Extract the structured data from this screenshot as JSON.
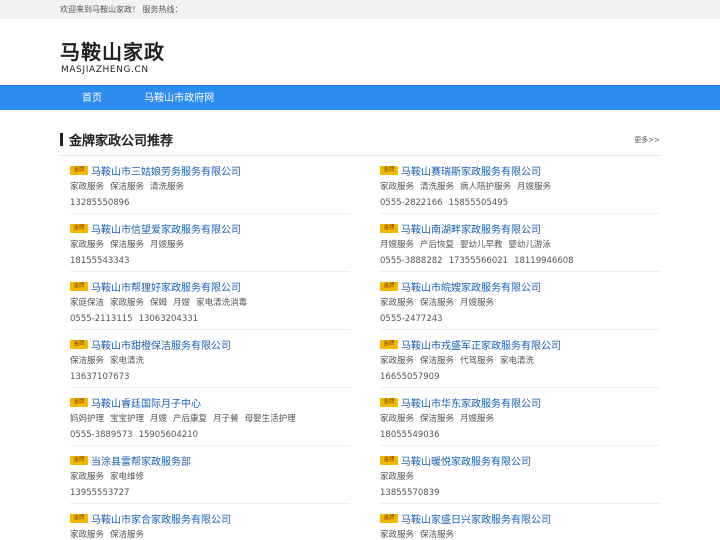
{
  "topbar": {
    "text": "欢迎来到马鞍山家政！  服务热线："
  },
  "logo": {
    "cn": "马鞍山家政",
    "en": "MASJIAZHENG.CN"
  },
  "nav": [
    {
      "label": "首页"
    },
    {
      "label": "马鞍山市政府网"
    }
  ],
  "section": {
    "title": "金牌家政公司推荐",
    "more": "更多>>",
    "badge": "金牌"
  },
  "companies_left": [
    {
      "name": "马鞍山市三姑娘劳务服务有限公司",
      "services": [
        "家政服务",
        "保洁服务",
        "清洗服务"
      ],
      "phones": [
        "13285550896"
      ]
    },
    {
      "name": "马鞍山市信望爱家政服务有限公司",
      "services": [
        "家政服务",
        "保洁服务",
        "月嫂服务"
      ],
      "phones": [
        "18155543343"
      ]
    },
    {
      "name": "马鞍山市帮狸好家政服务有限公司",
      "services": [
        "家庭保洁",
        "家政服务",
        "保姆",
        "月嫂",
        "家电清洗消毒"
      ],
      "phones": [
        "0555-2113115",
        "13063204331"
      ]
    },
    {
      "name": "马鞍山市甜橙保洁服务有限公司",
      "services": [
        "保洁服务",
        "家电清洗"
      ],
      "phones": [
        "13637107673"
      ]
    },
    {
      "name": "马鞍山睿廷国际月子中心",
      "services": [
        "妈妈护理",
        "宝宝护理",
        "月嫂",
        "产后康复",
        "月子餐",
        "母婴生活护理"
      ],
      "phones": [
        "0555-3889573",
        "15905604210"
      ]
    },
    {
      "name": "当涂县雷帮家政服务部",
      "services": [
        "家政服务",
        "家电维修"
      ],
      "phones": [
        "13955553727"
      ]
    },
    {
      "name": "马鞍山市家合家政服务有限公司",
      "services": [
        "家政服务",
        "保洁服务"
      ],
      "phones": []
    }
  ],
  "companies_right": [
    {
      "name": "马鞍山赛瑞斯家政服务有限公司",
      "services": [
        "家政服务",
        "清洗服务",
        "病人陪护服务",
        "月嫂服务"
      ],
      "phones": [
        "0555-2822166",
        "15855505495"
      ]
    },
    {
      "name": "马鞍山南湖畔家政服务有限公司",
      "services": [
        "月嫂服务",
        "产后恢复",
        "婴幼儿早教",
        "婴幼儿游泳"
      ],
      "phones": [
        "0555-3888282",
        "17355566021",
        "18119946608"
      ]
    },
    {
      "name": "马鞍山市皖嫂家政服务有限公司",
      "services": [
        "家政服务",
        "保洁服务",
        "月嫂服务"
      ],
      "phones": [
        "0555-2477243"
      ]
    },
    {
      "name": "马鞍山市戎盛军正家政服务有限公司",
      "services": [
        "家政服务",
        "保洁服务",
        "代驾服务",
        "家电清洗"
      ],
      "phones": [
        "16655057909"
      ]
    },
    {
      "name": "马鞍山市华东家政服务有限公司",
      "services": [
        "家政服务",
        "保洁服务",
        "月嫂服务"
      ],
      "phones": [
        "18055549036"
      ]
    },
    {
      "name": "马鞍山暖悦家政服务有限公司",
      "services": [
        "家政服务"
      ],
      "phones": [
        "13855570839"
      ]
    },
    {
      "name": "马鞍山家盛日兴家政服务有限公司",
      "services": [
        "家政服务",
        "保洁服务"
      ],
      "phones": []
    }
  ]
}
